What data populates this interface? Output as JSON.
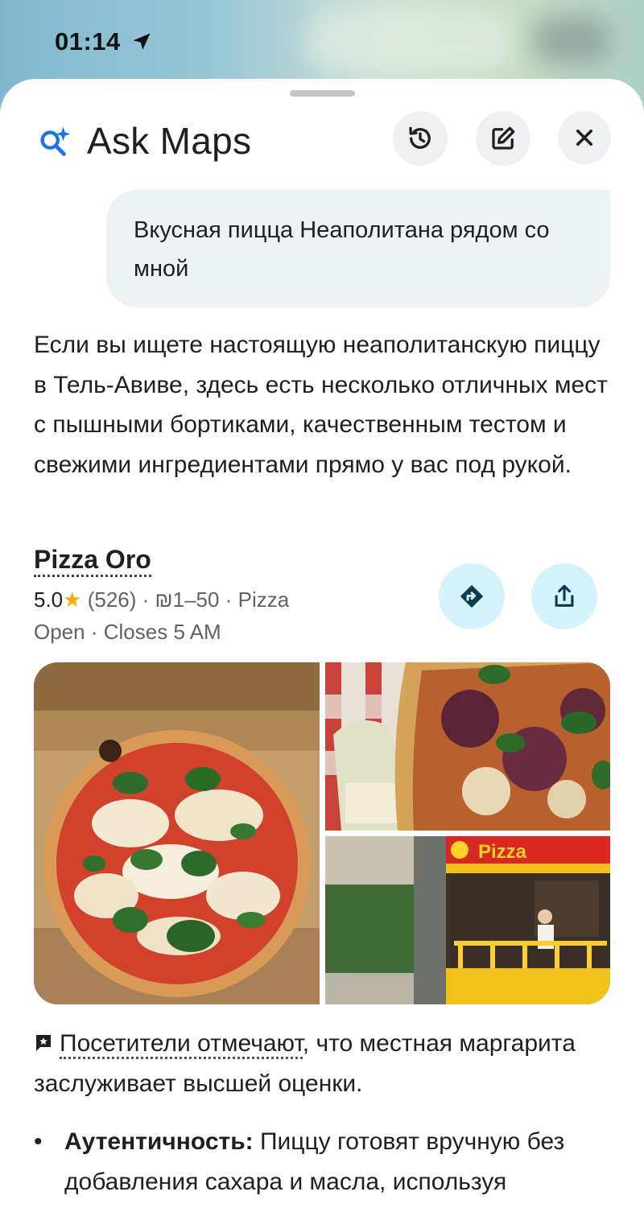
{
  "status_bar": {
    "time": "01:14",
    "location_icon": "location-arrow-icon"
  },
  "header": {
    "title": "Ask Maps",
    "icon": "sparkle-search-icon",
    "buttons": [
      "history-icon",
      "edit-icon",
      "close-icon"
    ]
  },
  "chat": {
    "user_message": "Вкусная пицца Неаполитана рядом со мной",
    "answer": "Если вы ищете настоящую неаполитанскую пиццу в Тель-Авиве, здесь есть несколько отличных мест с пышными бортиками, качественным тестом и свежими ингредиентами прямо у вас под рукой."
  },
  "place": {
    "name": "Pizza Oro",
    "rating": "5.0",
    "star": "★",
    "reviews": "(526)",
    "price": "₪1–50",
    "category": "Pizza",
    "separator": "·",
    "open_status": "Open",
    "closes": "Closes 5 AM",
    "actions": [
      "directions-icon",
      "share-icon"
    ],
    "photo_sign_text": "Pizza"
  },
  "mentions": {
    "link": "Посетители отмечают",
    "rest": ", что местная маргарита заслуживает высшей оценки."
  },
  "bullets": [
    {
      "bullet": "•",
      "title": "Аутентичность:",
      "text": " Пиццу готовят вручную без добавления сахара и масла, используя"
    }
  ],
  "colors": {
    "accent_blue": "#1a73e8",
    "star": "#f9ab00",
    "action_button_bg": "#d5f3fc",
    "bubble_bg": "#edf2f5"
  }
}
